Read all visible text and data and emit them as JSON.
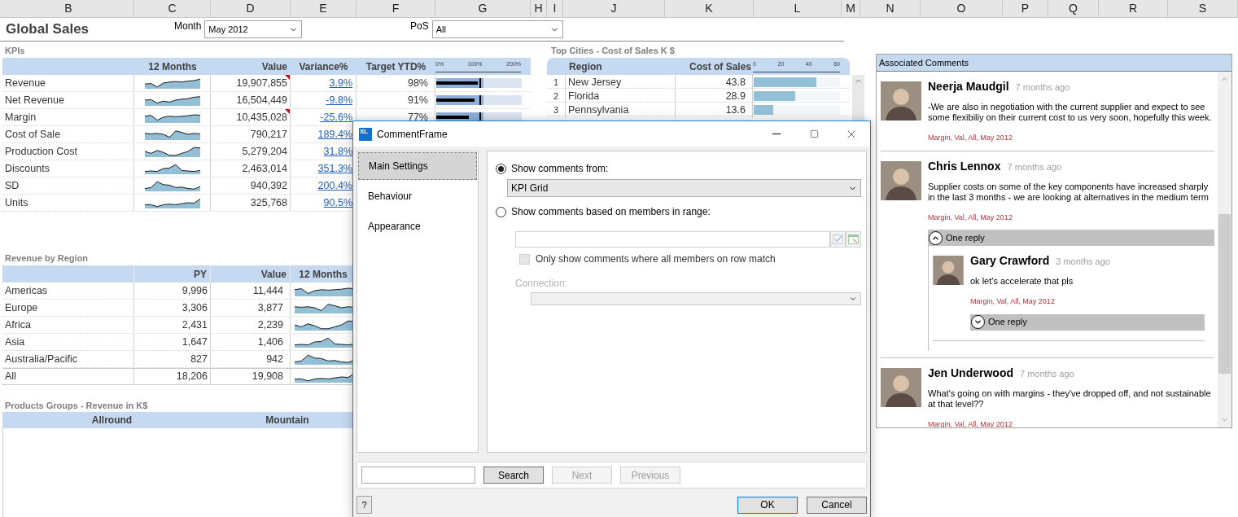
{
  "column_headers": [
    "B",
    "C",
    "D",
    "E",
    "F",
    "G",
    "H",
    "I",
    "J",
    "K",
    "L",
    "M",
    "N",
    "O",
    "P",
    "Q",
    "R",
    "S"
  ],
  "title": "Global Sales",
  "filters": [
    {
      "label": "Month",
      "value": "May 2012"
    },
    {
      "label": "PoS",
      "value": "All"
    }
  ],
  "kpis": {
    "title": "KPIs",
    "columns": [
      "12 Months",
      "Value",
      "Variance%",
      "Target YTD%"
    ],
    "axis_ticks": [
      "0%",
      "100%",
      "200%"
    ],
    "rows": [
      {
        "name": "Revenue",
        "value": "19,907,855",
        "flagged": true,
        "variance": "3.9%",
        "target": "98%",
        "level": 0.49
      },
      {
        "name": "Net Revenue",
        "value": "16,504,449",
        "flagged": false,
        "variance": "-9.8%",
        "target": "91%",
        "level": 0.45
      },
      {
        "name": "Margin",
        "value": "10,435,028",
        "flagged": true,
        "variance": "-25.6%",
        "target": "77%",
        "level": 0.38
      },
      {
        "name": "Cost of Sale",
        "value": "790,217",
        "flagged": false,
        "variance": "189.4%"
      },
      {
        "name": "Production Cost",
        "value": "5,279,204",
        "flagged": false,
        "variance": "31.8%"
      },
      {
        "name": "Discounts",
        "value": "2,463,014",
        "flagged": false,
        "variance": "351.3%"
      },
      {
        "name": "SD",
        "value": "940,392",
        "flagged": false,
        "variance": "200.4%"
      },
      {
        "name": "Units",
        "value": "325,768",
        "flagged": false,
        "variance": "90.5%"
      }
    ]
  },
  "revenue_by_region": {
    "title": "Revenue by Region",
    "columns": [
      "PY",
      "Value",
      "12 Months"
    ],
    "rows": [
      {
        "kind": "region",
        "name": "Americas",
        "py": "9,996",
        "value": "11,444"
      },
      {
        "kind": "region",
        "name": "Europe",
        "py": "3,306",
        "value": "3,877"
      },
      {
        "kind": "region",
        "name": "Africa",
        "py": "2,431",
        "value": "2,239"
      },
      {
        "kind": "region",
        "name": "Asia",
        "py": "1,647",
        "value": "1,406"
      },
      {
        "kind": "region",
        "name": "Australia/Pacific",
        "py": "827",
        "value": "942"
      },
      {
        "kind": "total",
        "name": "All",
        "py": "18,206",
        "value": "19,908"
      }
    ]
  },
  "product_groups": {
    "title": "Products Groups - Revenue in K$",
    "columns": [
      "Allround",
      "Mountain"
    ]
  },
  "top_cities": {
    "title": "Top Cities - Cost of Sales K $",
    "columns": [
      "Region",
      "Cost of Sales"
    ],
    "axis_ticks": [
      "0",
      "20",
      "40",
      "60"
    ],
    "rows": [
      {
        "rank": "1",
        "name": "New Jersey",
        "value": "43.8",
        "level": 0.73
      },
      {
        "rank": "2",
        "name": "Florida",
        "value": "28.9",
        "level": 0.48
      },
      {
        "rank": "3",
        "name": "Pennsylvania",
        "value": "13.6",
        "level": 0.23
      }
    ]
  },
  "comments_panel": {
    "title": "Associated Comments",
    "comments": [
      {
        "author": "Neerja Maudgil",
        "time": "7 months ago",
        "text": "-We are also in negotiation with the current supplier and expect to see some flexibiliy on their current cost to us very soon, hopefully this week.",
        "tags": "Margin, Val, All, May 2012"
      },
      {
        "author": "Chris Lennox",
        "time": "7 months ago",
        "text": "Supplier costs on some of the key components have increased sharply in the last 3 months - we are looking at alternatives in the medium term",
        "tags": "Margin, Val, All, May 2012",
        "replies": {
          "label": "One reply",
          "expanded": true,
          "children": [
            {
              "author": "Gary Crawford",
              "time": "3 months ago",
              "text": "ok let's accelerate that pls",
              "tags": "Margin, Val, All, May 2012",
              "replies": {
                "label": "One reply",
                "expanded": false
              }
            }
          ]
        }
      },
      {
        "author": "Jen Underwood",
        "time": "7 months ago",
        "text": "What's going on with margins - they've dropped off, and not sustainable at that level??",
        "tags": "Margin, Val, All, May 2012"
      }
    ]
  },
  "dialog": {
    "title": "CommentFrame",
    "logo": "XL",
    "nav": [
      {
        "label": "Main Settings",
        "selected": true
      },
      {
        "label": "Behaviour",
        "selected": false
      },
      {
        "label": "Appearance",
        "selected": false
      }
    ],
    "options": [
      {
        "label": "Show comments from:",
        "selected": true
      },
      {
        "label": "Show comments based on members in range:",
        "selected": false
      }
    ],
    "source_value": "KPI Grid",
    "row_match": {
      "label": "Only show comments where all members on row match",
      "checked": false,
      "disabled": true
    },
    "connection": {
      "label": "Connection:",
      "disabled": true
    },
    "search_buttons": [
      {
        "label": "Search",
        "disabled": false
      },
      {
        "label": "Next",
        "disabled": true
      },
      {
        "label": "Previous",
        "disabled": true
      }
    ],
    "help": "?",
    "buttons": [
      {
        "label": "OK",
        "default": true
      },
      {
        "label": "Cancel",
        "default": false
      }
    ]
  }
}
